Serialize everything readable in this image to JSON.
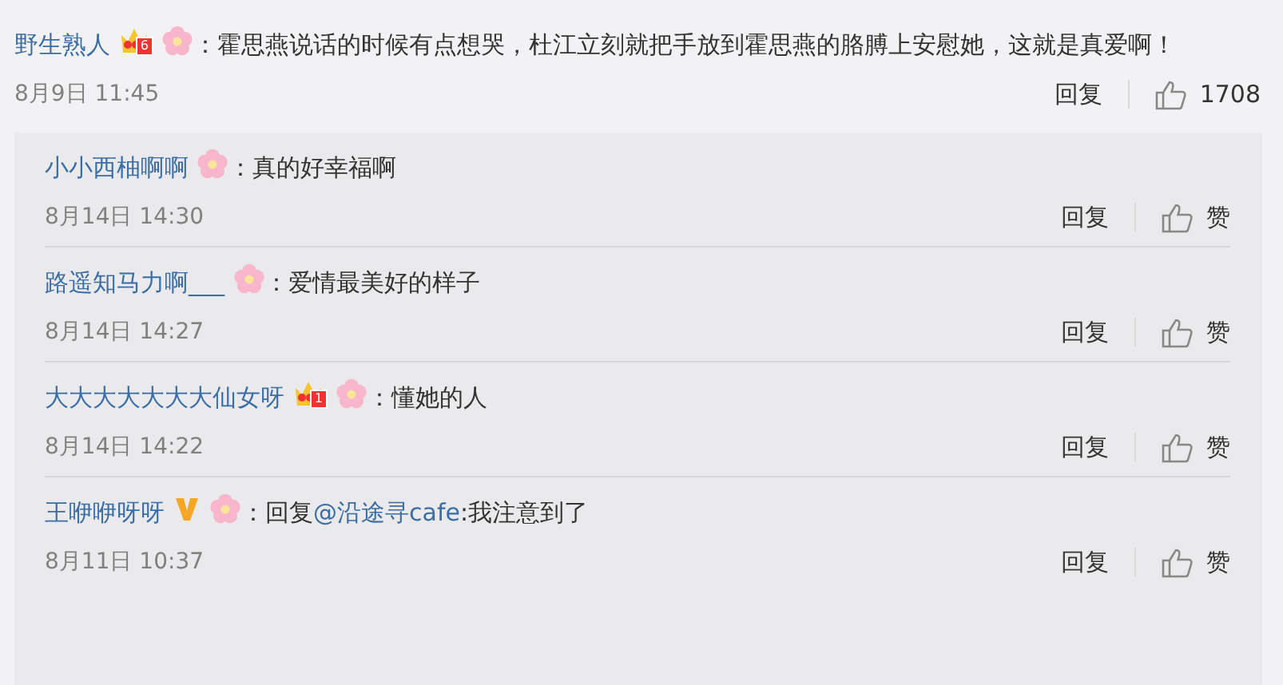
{
  "comment": {
    "user": "野生熟人",
    "badges": [
      {
        "kind": "crown",
        "text": "6"
      },
      {
        "kind": "flower"
      }
    ],
    "separator": "：",
    "text": "霍思燕说话的时候有点想哭，杜江立刻就把手放到霍思燕的胳膊上安慰她，这就是真爱啊！",
    "time": "8月9日 11:45",
    "reply_label": "回复",
    "like_label": "1708"
  },
  "replies": [
    {
      "user": "小小西柚啊啊",
      "badges": [
        {
          "kind": "flower"
        }
      ],
      "separator": "：",
      "text": "真的好幸福啊",
      "time": "8月14日 14:30",
      "reply_label": "回复",
      "like_label": "赞"
    },
    {
      "user": "路遥知马力啊___",
      "badges": [
        {
          "kind": "flower"
        }
      ],
      "separator": "：",
      "text": "爱情最美好的样子",
      "time": "8月14日 14:27",
      "reply_label": "回复",
      "like_label": "赞"
    },
    {
      "user": "大大大大大大大仙女呀",
      "badges": [
        {
          "kind": "crown",
          "text": "1"
        },
        {
          "kind": "flower"
        }
      ],
      "separator": "：",
      "text": "懂她的人",
      "time": "8月14日 14:22",
      "reply_label": "回复",
      "like_label": "赞"
    },
    {
      "user": "王咿咿呀呀",
      "badges": [
        {
          "kind": "vip"
        },
        {
          "kind": "flower"
        }
      ],
      "separator": "：",
      "prefix": "回复",
      "mention": "@沿途寻cafe",
      "text": ":我注意到了",
      "time": "8月11日 10:37",
      "reply_label": "回复",
      "like_label": "赞"
    }
  ]
}
